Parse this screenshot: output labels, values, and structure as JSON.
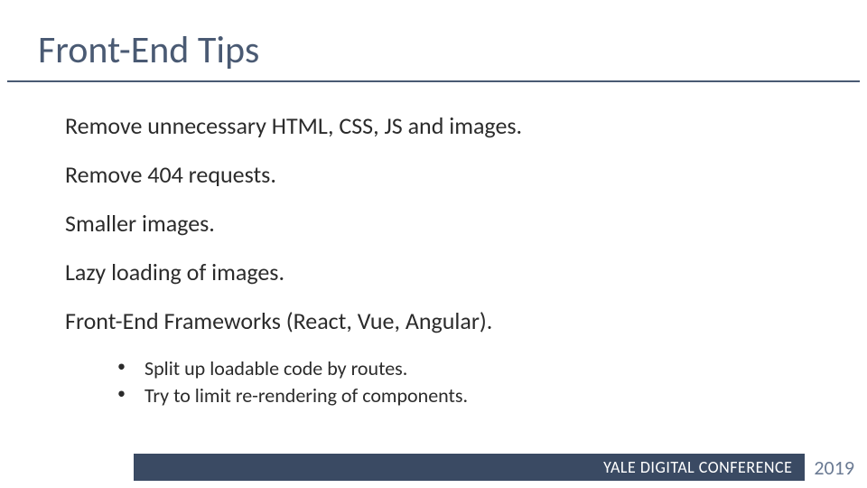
{
  "title": "Front-End Tips",
  "points": [
    "Remove unnecessary HTML, CSS, JS and images.",
    "Remove 404 requests.",
    "Smaller images.",
    "Lazy loading of images.",
    "Front-End Frameworks (React, Vue, Angular)."
  ],
  "subpoints": [
    "Split up loadable code by routes.",
    "Try to limit re-rendering of components."
  ],
  "footer": {
    "brand_strong": "YALE",
    "brand_light": "DIGITAL CONFERENCE",
    "year": "2019"
  }
}
